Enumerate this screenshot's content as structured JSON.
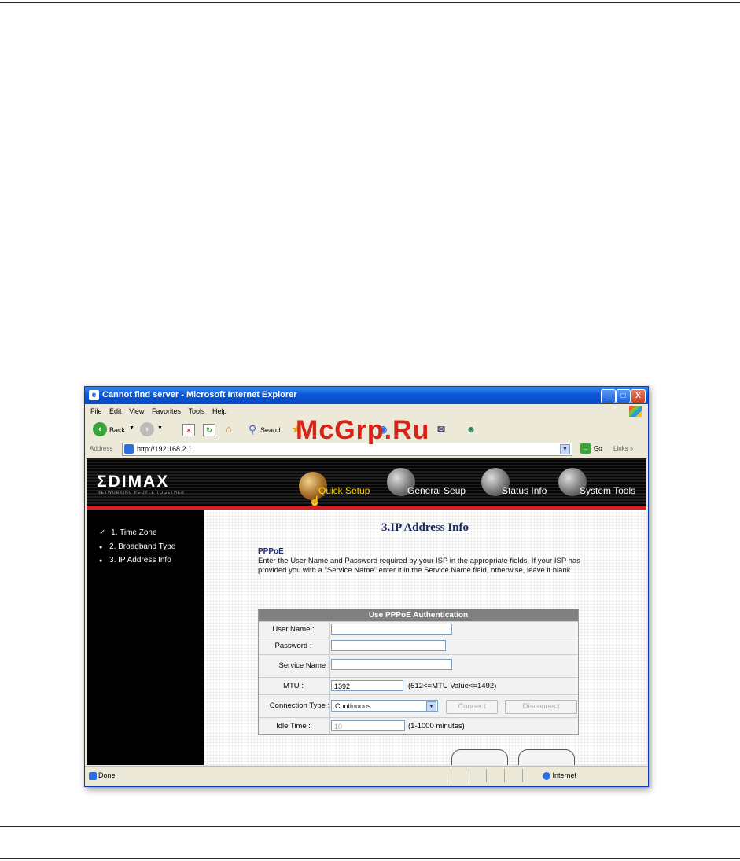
{
  "window": {
    "title": "Cannot find server - Microsoft Internet Explorer",
    "controls": {
      "minimize": "_",
      "maximize": "□",
      "close": "X"
    }
  },
  "menu": [
    "File",
    "Edit",
    "View",
    "Favorites",
    "Tools",
    "Help"
  ],
  "toolbar": {
    "back_label": "Back",
    "search_label": "Search"
  },
  "address": {
    "label": "Address",
    "url": "http://192.168.2.1",
    "go_label": "Go",
    "links_label": "Links »"
  },
  "banner": {
    "logo": "ΣDIMAX",
    "tagline": "NETWORKING PEOPLE TOGETHER",
    "nav": [
      "Quick Setup",
      "General Seup",
      "Status Info",
      "System Tools"
    ]
  },
  "sidebar": {
    "items": [
      {
        "bullet": "✓",
        "label": "1. Time Zone"
      },
      {
        "bullet": "●",
        "label": "2. Broadband Type"
      },
      {
        "bullet": "●",
        "label": "3. IP Address Info"
      }
    ]
  },
  "main": {
    "title": "3.IP Address Info",
    "type": "PPPoE",
    "description": "Enter the User Name and Password required by your ISP in the appropriate fields. If your ISP has provided you with a \"Service Name\" enter it in the Service Name field, otherwise, leave it blank."
  },
  "form": {
    "header": "Use PPPoE Authentication",
    "user_name_label": "User Name :",
    "user_name_value": "",
    "password_label": "Password :",
    "password_value": "",
    "service_name_label": "Service Name :",
    "service_name_value": "",
    "mtu_label": "MTU :",
    "mtu_value": "1392",
    "mtu_note": "(512<=MTU Value<=1492)",
    "connection_type_label": "Connection Type :",
    "connection_type_value": "Continuous",
    "connect_label": "Connect",
    "disconnect_label": "Disconnect",
    "idle_time_label": "Idle Time :",
    "idle_time_value": "10",
    "idle_time_note": "(1-1000 minutes)"
  },
  "status": {
    "text": "Done",
    "zone": "Internet"
  },
  "watermark": "McGrp.Ru"
}
